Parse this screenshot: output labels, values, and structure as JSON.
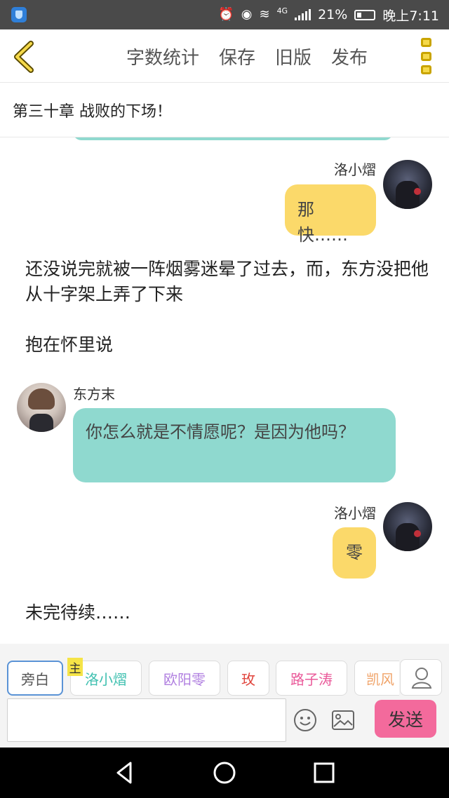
{
  "status_bar": {
    "battery_percent": "21%",
    "time": "晚上7:11",
    "network": "4G"
  },
  "toolbar": {
    "actions": [
      "字数统计",
      "保存",
      "旧版",
      "发布"
    ]
  },
  "chapter": {
    "title": "第三十章 战败的下场！"
  },
  "messages": [
    {
      "type": "bubble",
      "side": "right",
      "speaker": "洛小熠",
      "text": "那快……",
      "color": "#fbd96a"
    },
    {
      "type": "narration",
      "text": "还没说完就被一阵烟雾迷晕了过去，而，东方没把他从十字架上弄了下来"
    },
    {
      "type": "narration",
      "text": "抱在怀里说"
    },
    {
      "type": "bubble",
      "side": "left",
      "speaker": "东方末",
      "text": "你怎么就是不情愿呢？是因为他吗？",
      "color": "#8fd9cf"
    },
    {
      "type": "bubble",
      "side": "right",
      "speaker": "洛小熠",
      "text": "零",
      "color": "#fbd96a"
    },
    {
      "type": "narration",
      "text": "未完待续……"
    }
  ],
  "characters": [
    {
      "name": "旁白",
      "color": "#555555"
    },
    {
      "name": "洛小熠",
      "color": "#3fc0b0",
      "main_tag": "主"
    },
    {
      "name": "欧阳零",
      "color": "#b07fe0"
    },
    {
      "name": "玫",
      "color": "#e0453d"
    },
    {
      "name": "路子涛",
      "color": "#ea5a9a"
    },
    {
      "name": "凯风",
      "color": "#f0a46a"
    }
  ],
  "input": {
    "value": "",
    "placeholder": ""
  },
  "send_label": "发送",
  "icons": [
    "back-chevron-icon",
    "menu-icon",
    "user-icon",
    "emoji-icon",
    "image-icon",
    "nav-back-icon",
    "nav-home-icon",
    "nav-recents-icon"
  ]
}
